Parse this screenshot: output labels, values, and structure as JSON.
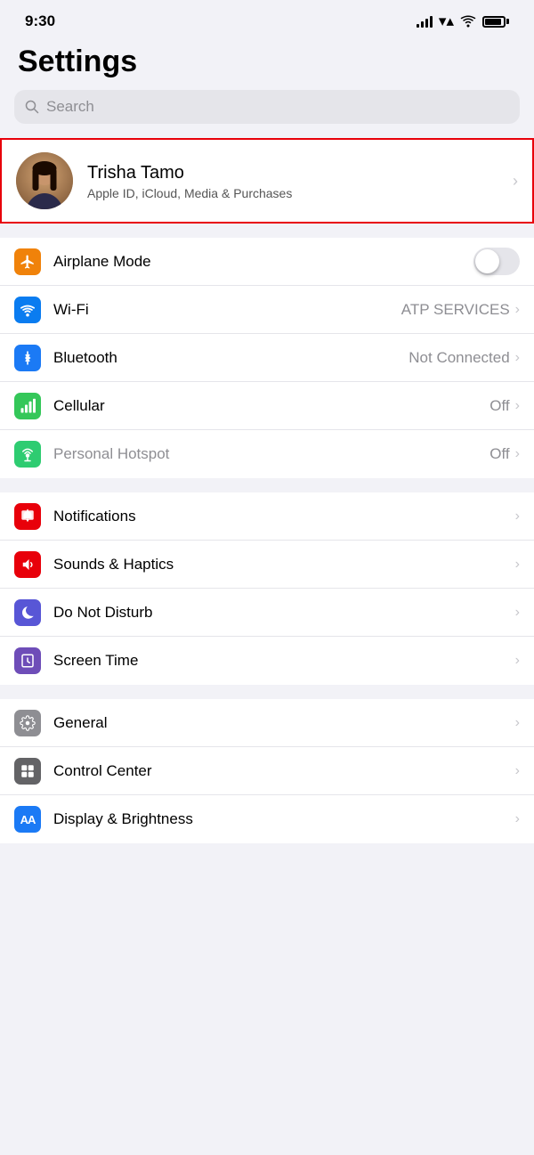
{
  "statusBar": {
    "time": "9:30"
  },
  "page": {
    "title": "Settings",
    "searchPlaceholder": "Search"
  },
  "profile": {
    "name": "Trisha Tamo",
    "subtitle": "Apple ID, iCloud, Media & Purchases"
  },
  "groups": [
    {
      "id": "connectivity",
      "items": [
        {
          "id": "airplane-mode",
          "label": "Airplane Mode",
          "icon": "✈",
          "iconClass": "icon-orange",
          "control": "toggle",
          "toggleOn": false,
          "value": "",
          "dimLabel": false
        },
        {
          "id": "wifi",
          "label": "Wi-Fi",
          "icon": "wifi",
          "iconClass": "icon-blue",
          "control": "chevron",
          "value": "ATP SERVICES",
          "dimLabel": false
        },
        {
          "id": "bluetooth",
          "label": "Bluetooth",
          "icon": "bluetooth",
          "iconClass": "icon-blue-mid",
          "control": "chevron",
          "value": "Not Connected",
          "dimLabel": false
        },
        {
          "id": "cellular",
          "label": "Cellular",
          "icon": "cellular",
          "iconClass": "icon-green-bright",
          "control": "chevron",
          "value": "Off",
          "dimLabel": false
        },
        {
          "id": "personal-hotspot",
          "label": "Personal Hotspot",
          "icon": "hotspot",
          "iconClass": "icon-green-teal",
          "control": "chevron",
          "value": "Off",
          "dimLabel": true
        }
      ]
    },
    {
      "id": "notifications-group",
      "items": [
        {
          "id": "notifications",
          "label": "Notifications",
          "icon": "notif",
          "iconClass": "icon-red",
          "control": "chevron",
          "value": "",
          "dimLabel": false
        },
        {
          "id": "sounds-haptics",
          "label": "Sounds & Haptics",
          "icon": "sound",
          "iconClass": "icon-red-pink",
          "control": "chevron",
          "value": "",
          "dimLabel": false
        },
        {
          "id": "do-not-disturb",
          "label": "Do Not Disturb",
          "icon": "moon",
          "iconClass": "icon-purple",
          "control": "chevron",
          "value": "",
          "dimLabel": false
        },
        {
          "id": "screen-time",
          "label": "Screen Time",
          "icon": "hourglass",
          "iconClass": "icon-purple-dark",
          "control": "chevron",
          "value": "",
          "dimLabel": false
        }
      ]
    },
    {
      "id": "general-group",
      "items": [
        {
          "id": "general",
          "label": "General",
          "icon": "gear",
          "iconClass": "icon-gray",
          "control": "chevron",
          "value": "",
          "dimLabel": false
        },
        {
          "id": "control-center",
          "label": "Control Center",
          "icon": "sliders",
          "iconClass": "icon-gray-mid",
          "control": "chevron",
          "value": "",
          "dimLabel": false
        },
        {
          "id": "display-brightness",
          "label": "Display & Brightness",
          "icon": "AA",
          "iconClass": "icon-blue",
          "control": "chevron",
          "value": "",
          "dimLabel": false
        }
      ]
    }
  ]
}
